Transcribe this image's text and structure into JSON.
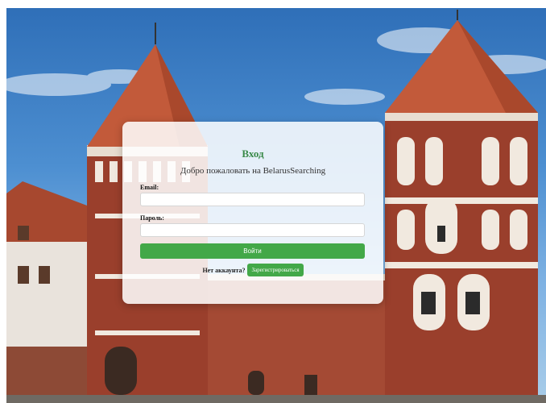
{
  "login": {
    "title": "Вход",
    "welcome": "Добро пожаловать на BelarusSearching",
    "email_label": "Email:",
    "email_value": "",
    "password_label": "Пароль:",
    "password_value": "",
    "submit_label": "Войти",
    "no_account_text": "Нет аккаунта?",
    "register_label": "Зарегистрироваться"
  },
  "colors": {
    "accent_green": "#43a848",
    "title_green": "#3a8a4a",
    "sky": "#4d8fd1",
    "brick": "#9a3f2c",
    "roof": "#c25a3a"
  },
  "background": {
    "subject": "castle-photo"
  }
}
